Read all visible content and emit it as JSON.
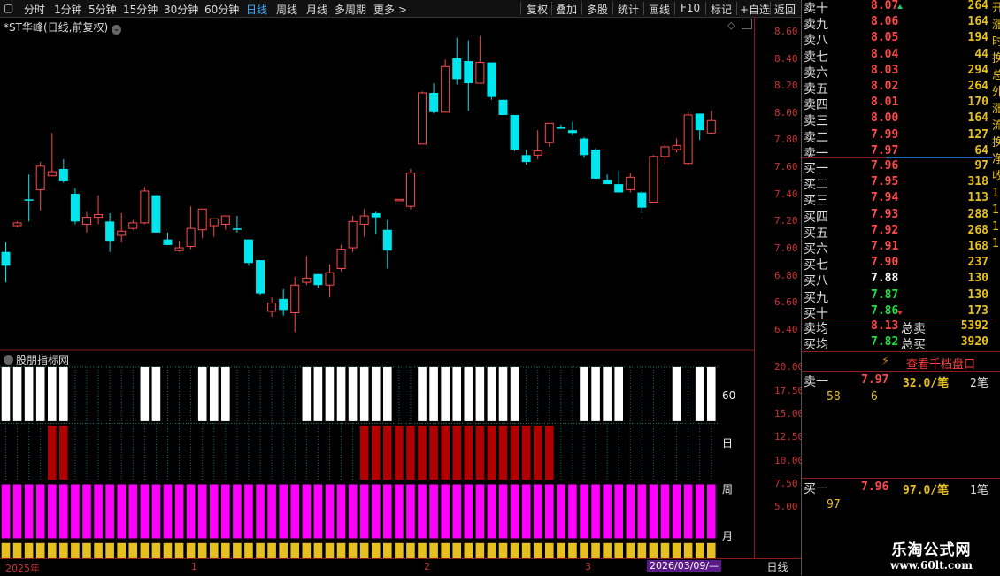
{
  "toolbar": {
    "tabs": [
      "分时",
      "1分钟",
      "5分钟",
      "15分钟",
      "30分钟",
      "60分钟",
      "日线",
      "周线",
      "月线",
      "多周期",
      "更多 >"
    ],
    "active_tab": "日线",
    "right_buttons": [
      "复权",
      "叠加",
      "多股",
      "统计",
      "画线",
      "F10",
      "标记",
      "+自选",
      "返回"
    ]
  },
  "chart": {
    "title": "*ST华峰(日线,前复权)",
    "yaxis_ticks": [
      "8.60",
      "8.40",
      "8.20",
      "8.00",
      "7.80",
      "7.60",
      "7.40",
      "7.20",
      "7.00",
      "6.80",
      "6.60",
      "6.40"
    ],
    "indicator_title": "股朋指标网",
    "indicator_ticks": [
      "20.00",
      "17.50",
      "15.00",
      "12.50",
      "10.00",
      "7.50",
      "5.00"
    ],
    "indicator_rows": [
      "60",
      "日",
      "周",
      "月"
    ],
    "bottom_dates": [
      "2025年",
      "1",
      "2",
      "3"
    ],
    "cursor_date": "2026/03/09/—",
    "period_button": "日线",
    "colors": {
      "up": "#ff4a4a",
      "down": "#00e5ee",
      "row60": "#ffffff",
      "rowDay": "#b00000",
      "rowWeek": "#ff00ff",
      "rowMonth": "#e6c020"
    }
  },
  "chart_data": {
    "type": "candlestick",
    "ylim": [
      6.32,
      8.7
    ],
    "candles": [
      {
        "o": 7.0,
        "h": 7.07,
        "l": 6.78,
        "c": 6.9
      },
      {
        "o": 7.19,
        "h": 7.22,
        "l": 7.18,
        "c": 7.21
      },
      {
        "o": 7.38,
        "h": 7.56,
        "l": 7.22,
        "c": 7.37
      },
      {
        "o": 7.45,
        "h": 7.65,
        "l": 7.3,
        "c": 7.62
      },
      {
        "o": 7.55,
        "h": 7.86,
        "l": 7.55,
        "c": 7.58
      },
      {
        "o": 7.6,
        "h": 7.67,
        "l": 7.5,
        "c": 7.51
      },
      {
        "o": 7.42,
        "h": 7.46,
        "l": 7.2,
        "c": 7.22
      },
      {
        "o": 7.2,
        "h": 7.29,
        "l": 7.14,
        "c": 7.25
      },
      {
        "o": 7.25,
        "h": 7.41,
        "l": 7.2,
        "c": 7.27
      },
      {
        "o": 7.22,
        "h": 7.28,
        "l": 7.0,
        "c": 7.08
      },
      {
        "o": 7.12,
        "h": 7.28,
        "l": 7.07,
        "c": 7.15
      },
      {
        "o": 7.17,
        "h": 7.23,
        "l": 7.16,
        "c": 7.21
      },
      {
        "o": 7.21,
        "h": 7.47,
        "l": 7.2,
        "c": 7.44
      },
      {
        "o": 7.41,
        "h": 7.41,
        "l": 7.14,
        "c": 7.14
      },
      {
        "o": 7.09,
        "h": 7.14,
        "l": 7.06,
        "c": 7.05
      },
      {
        "o": 7.01,
        "h": 7.08,
        "l": 7.0,
        "c": 7.03
      },
      {
        "o": 7.04,
        "h": 7.33,
        "l": 7.02,
        "c": 7.17
      },
      {
        "o": 7.16,
        "h": 7.28,
        "l": 7.1,
        "c": 7.31
      },
      {
        "o": 7.19,
        "h": 7.22,
        "l": 7.11,
        "c": 7.24
      },
      {
        "o": 7.2,
        "h": 7.24,
        "l": 7.16,
        "c": 7.26
      },
      {
        "o": 7.17,
        "h": 7.26,
        "l": 7.14,
        "c": 7.16
      },
      {
        "o": 7.09,
        "h": 7.05,
        "l": 6.9,
        "c": 6.92
      },
      {
        "o": 6.94,
        "h": 6.94,
        "l": 6.69,
        "c": 6.7
      },
      {
        "o": 6.57,
        "h": 6.67,
        "l": 6.53,
        "c": 6.63
      },
      {
        "o": 6.66,
        "h": 6.73,
        "l": 6.54,
        "c": 6.58
      },
      {
        "o": 6.56,
        "h": 6.82,
        "l": 6.42,
        "c": 6.76
      },
      {
        "o": 6.78,
        "h": 6.97,
        "l": 6.76,
        "c": 6.81
      },
      {
        "o": 6.84,
        "h": 6.81,
        "l": 6.74,
        "c": 6.76
      },
      {
        "o": 6.76,
        "h": 6.91,
        "l": 6.67,
        "c": 6.85
      },
      {
        "o": 6.88,
        "h": 7.05,
        "l": 6.86,
        "c": 7.02
      },
      {
        "o": 7.03,
        "h": 7.26,
        "l": 7.0,
        "c": 7.22
      },
      {
        "o": 7.2,
        "h": 7.31,
        "l": 7.11,
        "c": 7.26
      },
      {
        "o": 7.28,
        "h": 7.29,
        "l": 7.13,
        "c": 7.25
      },
      {
        "o": 7.16,
        "h": 7.23,
        "l": 6.88,
        "c": 7.01
      },
      {
        "o": 7.37,
        "h": 7.37,
        "l": 7.37,
        "c": 7.38
      },
      {
        "o": 7.33,
        "h": 7.6,
        "l": 7.31,
        "c": 7.57
      },
      {
        "o": 7.78,
        "h": 8.16,
        "l": 7.78,
        "c": 8.15
      },
      {
        "o": 8.15,
        "h": 8.22,
        "l": 8.0,
        "c": 8.01
      },
      {
        "o": 8.01,
        "h": 8.39,
        "l": 8.01,
        "c": 8.34
      },
      {
        "o": 8.4,
        "h": 8.55,
        "l": 8.21,
        "c": 8.25
      },
      {
        "o": 8.38,
        "h": 8.53,
        "l": 8.02,
        "c": 8.22
      },
      {
        "o": 8.22,
        "h": 8.56,
        "l": 8.22,
        "c": 8.37
      },
      {
        "o": 8.37,
        "h": 8.34,
        "l": 8.1,
        "c": 8.12
      },
      {
        "o": 8.1,
        "h": 8.1,
        "l": 7.99,
        "c": 7.99
      },
      {
        "o": 7.99,
        "h": 7.98,
        "l": 7.73,
        "c": 7.74
      },
      {
        "o": 7.7,
        "h": 7.74,
        "l": 7.63,
        "c": 7.65
      },
      {
        "o": 7.7,
        "h": 7.88,
        "l": 7.67,
        "c": 7.73
      },
      {
        "o": 7.79,
        "h": 7.93,
        "l": 7.76,
        "c": 7.93
      },
      {
        "o": 7.9,
        "h": 7.92,
        "l": 7.89,
        "c": 7.89
      },
      {
        "o": 7.88,
        "h": 7.94,
        "l": 7.84,
        "c": 7.86
      },
      {
        "o": 7.82,
        "h": 7.83,
        "l": 7.68,
        "c": 7.7
      },
      {
        "o": 7.74,
        "h": 7.75,
        "l": 7.54,
        "c": 7.53
      },
      {
        "o": 7.52,
        "h": 7.56,
        "l": 7.49,
        "c": 7.49
      },
      {
        "o": 7.49,
        "h": 7.59,
        "l": 7.44,
        "c": 7.43
      },
      {
        "o": 7.45,
        "h": 7.57,
        "l": 7.43,
        "c": 7.54
      },
      {
        "o": 7.43,
        "h": 7.44,
        "l": 7.28,
        "c": 7.32
      },
      {
        "o": 7.36,
        "h": 7.7,
        "l": 7.36,
        "c": 7.69
      },
      {
        "o": 7.69,
        "h": 7.78,
        "l": 7.64,
        "c": 7.76
      },
      {
        "o": 7.74,
        "h": 7.82,
        "l": 7.72,
        "c": 7.77
      },
      {
        "o": 7.64,
        "h": 8.01,
        "l": 7.63,
        "c": 7.99
      },
      {
        "o": 8.0,
        "h": 7.98,
        "l": 7.81,
        "c": 7.88
      },
      {
        "o": 7.86,
        "h": 8.02,
        "l": 7.85,
        "c": 7.95
      }
    ],
    "indicator": {
      "ylim": [
        3.5,
        21
      ],
      "row60_on": [
        1,
        1,
        1,
        1,
        1,
        1,
        0,
        0,
        0,
        0,
        0,
        0,
        1,
        1,
        0,
        0,
        0,
        1,
        1,
        1,
        0,
        0,
        0,
        0,
        0,
        0,
        1,
        1,
        1,
        1,
        1,
        1,
        1,
        1,
        0,
        0,
        1,
        1,
        1,
        1,
        1,
        1,
        1,
        1,
        1,
        0,
        0,
        0,
        0,
        0,
        1,
        1,
        1,
        1,
        0,
        0,
        0,
        0,
        1,
        0,
        1,
        1,
        1,
        1,
        1,
        1,
        1,
        1
      ],
      "rowDay_on": [
        0,
        0,
        0,
        0,
        1,
        1,
        0,
        0,
        0,
        0,
        0,
        0,
        0,
        0,
        0,
        0,
        0,
        0,
        0,
        0,
        0,
        0,
        0,
        0,
        0,
        0,
        0,
        0,
        0,
        0,
        0,
        1,
        1,
        1,
        1,
        1,
        1,
        1,
        1,
        1,
        1,
        1,
        1,
        1,
        1,
        1,
        1,
        1,
        0,
        0,
        0,
        0,
        0,
        0,
        0,
        0,
        0,
        0,
        0,
        0,
        0,
        0,
        0,
        0,
        0,
        1,
        1,
        0
      ],
      "rowWeek_on": 1,
      "rowMonth_on": 1
    }
  },
  "orderbook": {
    "asks": [
      {
        "name": "卖十",
        "price": "8.07",
        "vol": "264",
        "color": "#ff4a4a",
        "arrow": "up"
      },
      {
        "name": "卖九",
        "price": "8.06",
        "vol": "164",
        "color": "#ff4a4a"
      },
      {
        "name": "卖八",
        "price": "8.05",
        "vol": "194",
        "color": "#ff4a4a"
      },
      {
        "name": "卖七",
        "price": "8.04",
        "vol": "44",
        "color": "#ff4a4a"
      },
      {
        "name": "卖六",
        "price": "8.03",
        "vol": "294",
        "color": "#ff4a4a"
      },
      {
        "name": "卖五",
        "price": "8.02",
        "vol": "264",
        "color": "#ff4a4a"
      },
      {
        "name": "卖四",
        "price": "8.01",
        "vol": "170",
        "color": "#ff4a4a"
      },
      {
        "name": "卖三",
        "price": "8.00",
        "vol": "164",
        "color": "#ff4a4a"
      },
      {
        "name": "卖二",
        "price": "7.99",
        "vol": "127",
        "color": "#ff4a4a"
      },
      {
        "name": "卖一",
        "price": "7.97",
        "vol": "64",
        "color": "#ff4a4a"
      }
    ],
    "bids": [
      {
        "name": "买一",
        "price": "7.96",
        "vol": "97",
        "color": "#ff4a4a"
      },
      {
        "name": "买二",
        "price": "7.95",
        "vol": "318",
        "color": "#ff4a4a"
      },
      {
        "name": "买三",
        "price": "7.94",
        "vol": "113",
        "color": "#ff4a4a"
      },
      {
        "name": "买四",
        "price": "7.93",
        "vol": "288",
        "color": "#ff4a4a"
      },
      {
        "name": "买五",
        "price": "7.92",
        "vol": "268",
        "color": "#ff4a4a"
      },
      {
        "name": "买六",
        "price": "7.91",
        "vol": "168",
        "color": "#ff4a4a"
      },
      {
        "name": "买七",
        "price": "7.90",
        "vol": "237",
        "color": "#ff4a4a"
      },
      {
        "name": "买八",
        "price": "7.88",
        "vol": "130",
        "color": "#ffffff"
      },
      {
        "name": "买九",
        "price": "7.87",
        "vol": "130",
        "color": "#22dd44"
      },
      {
        "name": "买十",
        "price": "7.86",
        "vol": "173",
        "color": "#22dd44",
        "arrow": "down"
      }
    ],
    "summary": [
      {
        "name": "卖均",
        "price": "8.13",
        "label": "总卖",
        "vol": "5392",
        "color": "#ff4a4a"
      },
      {
        "name": "买均",
        "price": "7.82",
        "label": "总买",
        "vol": "3920",
        "color": "#22dd44"
      }
    ],
    "qian_button": "查看千档盘口",
    "ask1_detail": {
      "name": "卖一",
      "price": "7.97",
      "qty": "32.0/笔",
      "count": "2笔",
      "sub1": "58",
      "sub2": "6"
    },
    "bid1_detail": {
      "name": "买一",
      "price": "7.96",
      "qty": "97.0/笔",
      "count": "1笔",
      "sub1": "97"
    },
    "cutoff_text": "开涨时换总外涨流换净收1111"
  },
  "logo": {
    "line1": "乐淘公式网",
    "line2": "www.60lt.com"
  }
}
